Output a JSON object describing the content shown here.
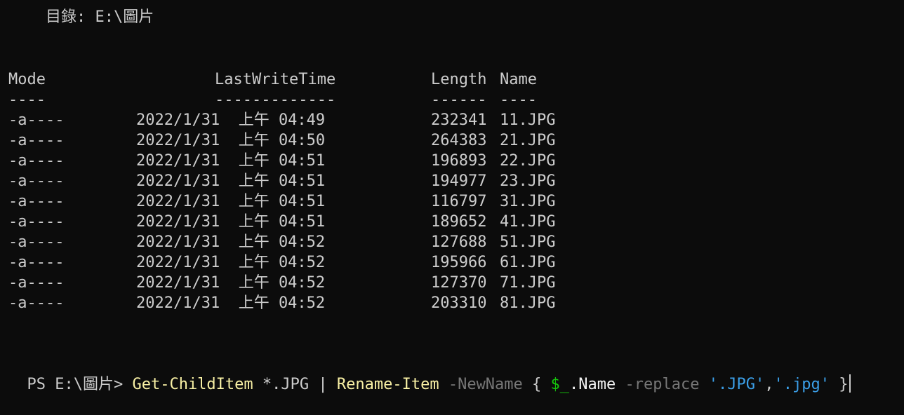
{
  "directory_line": "    目錄: E:\\圖片",
  "columns": {
    "mode": "Mode",
    "last_write_time": "LastWriteTime",
    "length": "Length",
    "name": "Name",
    "mode_sep": "----",
    "time_sep": "-------------",
    "length_sep": "------",
    "name_sep": "----"
  },
  "rows": [
    {
      "mode": "-a----",
      "time": "2022/1/31  上午 04:49",
      "length": "232341",
      "name": "11.JPG"
    },
    {
      "mode": "-a----",
      "time": "2022/1/31  上午 04:50",
      "length": "264383",
      "name": "21.JPG"
    },
    {
      "mode": "-a----",
      "time": "2022/1/31  上午 04:51",
      "length": "196893",
      "name": "22.JPG"
    },
    {
      "mode": "-a----",
      "time": "2022/1/31  上午 04:51",
      "length": "194977",
      "name": "23.JPG"
    },
    {
      "mode": "-a----",
      "time": "2022/1/31  上午 04:51",
      "length": "116797",
      "name": "31.JPG"
    },
    {
      "mode": "-a----",
      "time": "2022/1/31  上午 04:51",
      "length": "189652",
      "name": "41.JPG"
    },
    {
      "mode": "-a----",
      "time": "2022/1/31  上午 04:52",
      "length": "127688",
      "name": "51.JPG"
    },
    {
      "mode": "-a----",
      "time": "2022/1/31  上午 04:52",
      "length": "195966",
      "name": "61.JPG"
    },
    {
      "mode": "-a----",
      "time": "2022/1/31  上午 04:52",
      "length": "127370",
      "name": "71.JPG"
    },
    {
      "mode": "-a----",
      "time": "2022/1/31  上午 04:52",
      "length": "203310",
      "name": "81.JPG"
    }
  ],
  "prompt": {
    "prefix": "PS E:\\圖片> ",
    "tokens": [
      {
        "text": "Get-ChildItem",
        "kind": "cmd"
      },
      {
        "text": " *.JPG | ",
        "kind": "plain"
      },
      {
        "text": "Rename-Item",
        "kind": "cmd"
      },
      {
        "text": " ",
        "kind": "plain"
      },
      {
        "text": "-NewName",
        "kind": "param"
      },
      {
        "text": " { ",
        "kind": "plain"
      },
      {
        "text": "$_",
        "kind": "var"
      },
      {
        "text": ".Name ",
        "kind": "white"
      },
      {
        "text": "-replace",
        "kind": "param"
      },
      {
        "text": " ",
        "kind": "plain"
      },
      {
        "text": "'.JPG'",
        "kind": "str"
      },
      {
        "text": ",",
        "kind": "plain"
      },
      {
        "text": "'.jpg'",
        "kind": "str"
      },
      {
        "text": " }",
        "kind": "plain"
      }
    ]
  },
  "colors": {
    "background": "#0c0c0c",
    "foreground": "#cccccc",
    "command": "#f9f1a5",
    "parameter": "#767676",
    "variable": "#16c60c",
    "string": "#3b9fe8"
  }
}
